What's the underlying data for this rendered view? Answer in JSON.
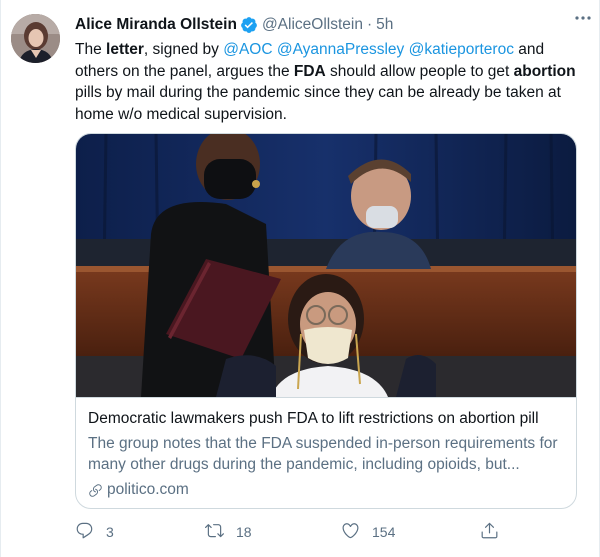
{
  "tweet": {
    "display_name": "Alice Miranda Ollstein",
    "handle": "@AliceOllstein",
    "separator": "·",
    "time": "5h",
    "text": {
      "p1": "The ",
      "w_letter": "letter",
      "p2": ", signed by ",
      "m1": "@AOC",
      "s1": " ",
      "m2": "@AyannaPressley",
      "s2": " ",
      "m3": "@katieporteroc",
      "p3": " and others on the panel, argues the ",
      "w_fda": "FDA",
      "p4": " should allow people to get ",
      "w_abortion": "abortion",
      "p5": " pills by mail during the pandemic since they can be already be taken at home w/o medical supervision."
    }
  },
  "card": {
    "title": "Democratic lawmakers push FDA to lift restrictions on abortion pill",
    "description": "The group notes that the FDA suspended in-person requirements for many other drugs during the pandemic, including opioids, but...",
    "domain": "politico.com"
  },
  "actions": {
    "reply_count": "3",
    "retweet_count": "18",
    "like_count": "154"
  },
  "icons": {
    "verified": "verified-badge-icon",
    "more": "more-options-icon",
    "link": "link-icon",
    "reply": "reply-icon",
    "retweet": "retweet-icon",
    "like": "heart-icon",
    "share": "share-icon"
  },
  "colors": {
    "link": "#1b95e0",
    "secondary_text": "#5b7083",
    "verified": "#1da1f2",
    "border": "#cfd9de"
  }
}
